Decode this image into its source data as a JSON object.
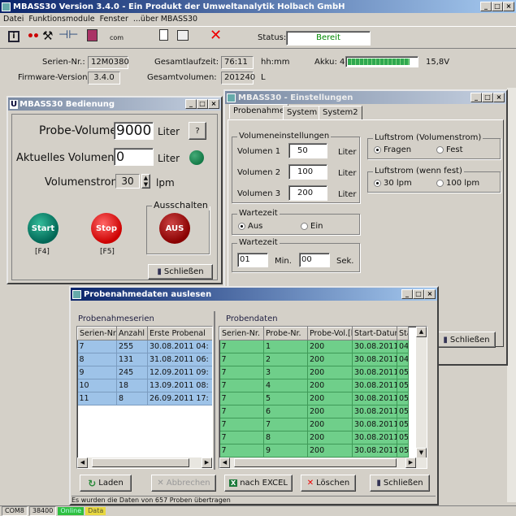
{
  "app": {
    "title": "MBASS30 Version 3.4.0  - Ein Produkt der Umweltanalytik Holbach GmbH",
    "menu": [
      "Datei",
      "Funktionsmodule",
      "Fenster",
      "...über MBASS30"
    ],
    "toolbar": {
      "com_label": "com",
      "status_label": "Status:",
      "status_value": "Bereit"
    },
    "info": {
      "serien_label": "Serien-Nr.:",
      "serien_value": "12M0380",
      "laufzeit_label": "Gesamtlaufzeit:",
      "laufzeit_value": "76:11",
      "laufzeit_unit": "hh:mm",
      "akku_label": "Akku: 4",
      "akku_level": 0.9,
      "akku_value": "15,8V",
      "firmware_label": "Firmware-Version:",
      "firmware_value": "3.4.0",
      "volumen_label": "Gesamtvolumen:",
      "volumen_value": "201240",
      "volumen_unit": "L"
    },
    "statusbar": {
      "port": "COM8",
      "baud": "38400",
      "online": "Online",
      "data": "Data"
    }
  },
  "bedienung": {
    "title": "MBASS30 Bedienung",
    "icon_letter": "U",
    "probe_label": "Probe-Volumen:",
    "probe_value": "9000",
    "probe_unit": "Liter",
    "help": "?",
    "akt_label": "Aktuelles Volumen:",
    "akt_value": "0",
    "akt_unit": "Liter",
    "strom_label": "Volumenstrom:",
    "strom_value": "30",
    "strom_unit": "lpm",
    "aus_group": "Ausschalten",
    "start": "Start",
    "start_key": "[F4]",
    "stop": "Stop",
    "stop_key": "[F5]",
    "aus": "AUS",
    "close": "Schließen"
  },
  "einstellungen": {
    "title": "MBASS30 - Einstellungen",
    "tabs": [
      "Probenahme",
      "System",
      "System2"
    ],
    "vol_group": "Volumeneinstellungen",
    "v1_label": "Volumen 1",
    "v1": "50",
    "v2_label": "Volumen 2",
    "v2": "100",
    "v3_label": "Volumen 3",
    "v3": "200",
    "unit": "Liter",
    "luft_group": "Luftstrom (Volumenstrom)",
    "fragen": "Fragen",
    "fest": "Fest",
    "luftfest_group": "Luftstrom (wenn fest)",
    "lpm30": "30 lpm",
    "lpm100": "100 lpm",
    "warte1_group": "Wartezeit",
    "aus": "Aus",
    "ein": "Ein",
    "warte2_group": "Wartezeit",
    "min_value": "01",
    "min_unit": "Min.",
    "sek_value": "00",
    "sek_unit": "Sek.",
    "close": "Schließen"
  },
  "proben": {
    "title": "Probenahmedaten auslesen",
    "left_label": "Probenahmeserien",
    "left_headers": [
      "Serien-Nr.",
      "Anzahl",
      "Erste Probenal"
    ],
    "left_rows": [
      [
        "7",
        "255",
        "30.08.2011 04:"
      ],
      [
        "8",
        "131",
        "31.08.2011 06:"
      ],
      [
        "9",
        "245",
        "12.09.2011 09:"
      ],
      [
        "10",
        "18",
        "13.09.2011 08:"
      ],
      [
        "11",
        "8",
        "26.09.2011 17:"
      ]
    ],
    "right_label": "Probendaten",
    "right_headers": [
      "Serien-Nr.",
      "Probe-Nr.",
      "Probe-Vol.[l",
      "Start-Datum",
      "Sta"
    ],
    "right_rows": [
      [
        "7",
        "1",
        "200",
        "30.08.2011",
        "04:"
      ],
      [
        "7",
        "2",
        "200",
        "30.08.2011",
        "04:"
      ],
      [
        "7",
        "3",
        "200",
        "30.08.2011",
        "05:"
      ],
      [
        "7",
        "4",
        "200",
        "30.08.2011",
        "05:"
      ],
      [
        "7",
        "5",
        "200",
        "30.08.2011",
        "05:"
      ],
      [
        "7",
        "6",
        "200",
        "30.08.2011",
        "05:"
      ],
      [
        "7",
        "7",
        "200",
        "30.08.2011",
        "05:"
      ],
      [
        "7",
        "8",
        "200",
        "30.08.2011",
        "05:"
      ],
      [
        "7",
        "9",
        "200",
        "30.08.2011",
        "05:"
      ]
    ],
    "laden": "Laden",
    "abbrechen": "Abbrechen",
    "excel": "nach EXCEL",
    "loeschen": "Löschen",
    "close": "Schließen",
    "status": "Es wurden die Daten von 657 Proben übertragen"
  }
}
